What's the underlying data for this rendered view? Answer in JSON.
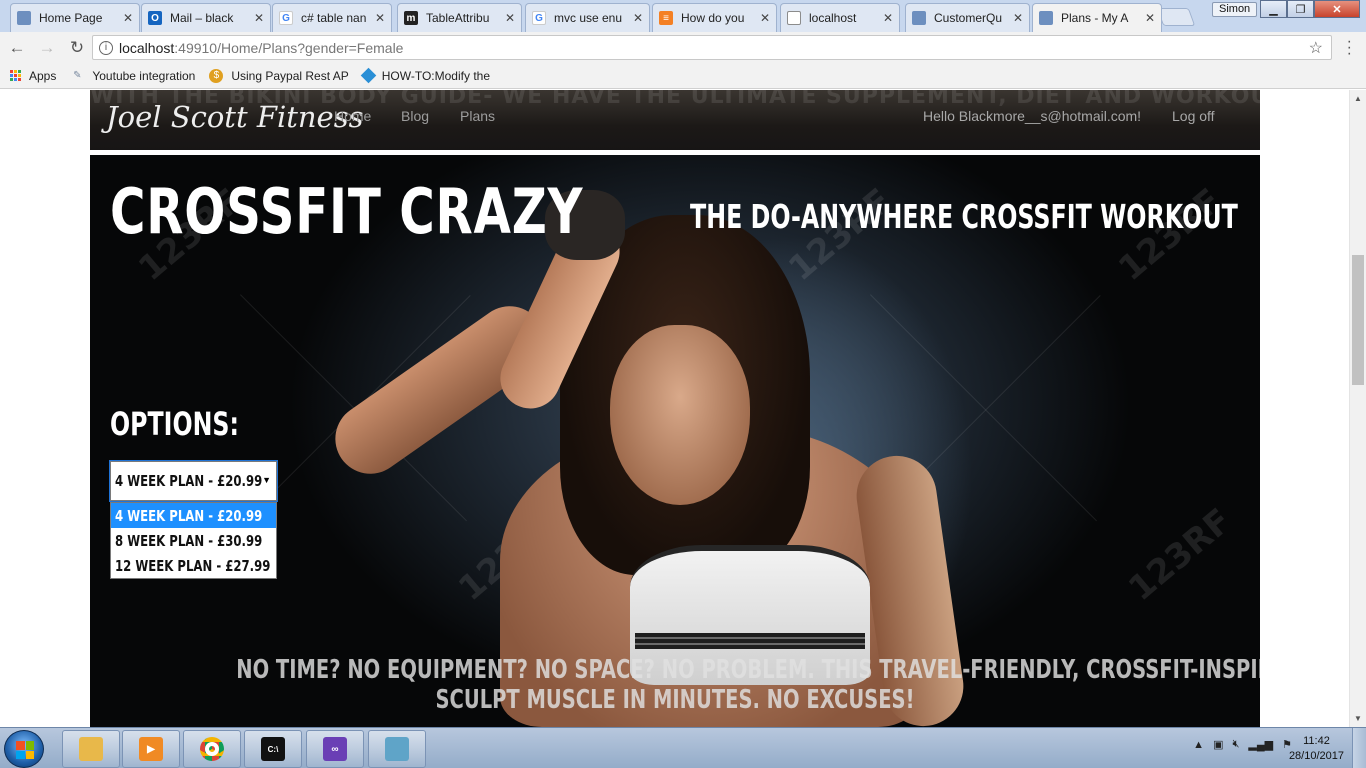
{
  "browser": {
    "tabs": [
      {
        "title": "Home Page",
        "icon": "page-icon",
        "color": "#6d8fbf"
      },
      {
        "title": "Mail – black",
        "icon": "outlook-icon",
        "color": "#1565c0"
      },
      {
        "title": "c# table nan",
        "icon": "google-icon",
        "color": "#4285f4"
      },
      {
        "title": "TableAttribu",
        "icon": "medium-icon",
        "color": "#222222"
      },
      {
        "title": "mvc use enu",
        "icon": "google-icon",
        "color": "#4285f4"
      },
      {
        "title": "How do you",
        "icon": "stackoverflow-icon",
        "color": "#f48024"
      },
      {
        "title": "localhost",
        "icon": "page-icon",
        "color": "#8c8c8c"
      },
      {
        "title": "CustomerQu",
        "icon": "page-icon",
        "color": "#6d8fbf"
      },
      {
        "title": "Plans - My A",
        "icon": "page-icon",
        "color": "#6d8fbf",
        "active": true
      }
    ],
    "profile": "Simon",
    "url_host": "localhost",
    "url_path": ":49910/Home/Plans?gender=Female",
    "bookmarks": {
      "apps_label": "Apps",
      "items": [
        {
          "label": "Youtube integration",
          "icon": "feather-icon"
        },
        {
          "label": "Using Paypal Rest AP",
          "icon": "coin-icon"
        },
        {
          "label": "HOW-TO:Modify the",
          "icon": "diamond-icon"
        }
      ]
    }
  },
  "site": {
    "banner_text": "WITH THE BIKINI BODY GUIDE- WE HAVE THE ULTIMATE SUPPLEMENT, DIET AND WORKOUT REGIME FOR YOU TO FOLLOW THIS SUMMER.",
    "brand": "Joel Scott Fitness",
    "nav": {
      "home": "Home",
      "blog": "Blog",
      "plans": "Plans"
    },
    "greeting": "Hello Blackmore__s@hotmail.com!",
    "logoff": "Log off"
  },
  "hero": {
    "title": "CROSSFIT CRAZY",
    "subtitle": "THE DO-ANYWHERE CROSSFIT WORKOUT",
    "options_label": "OPTIONS:",
    "selected_option": "4 WEEK PLAN - £20.99",
    "options": [
      "4 WEEK PLAN - £20.99",
      "8 WEEK PLAN - £30.99",
      "12 WEEK PLAN - £27.99"
    ],
    "tagline_line1": "NO TIME? NO EQUIPMENT? NO SPACE? NO PROBLEM. THIS TRAVEL-FRIENDLY, CROSSFIT-INSPIRED WORKOUT WILL BLAST FAT AND",
    "tagline_line2": "SCULPT MUSCLE IN MINUTES. NO EXCUSES!",
    "watermark": "123RF"
  },
  "taskbar": {
    "time": "11:42",
    "date": "28/10/2017",
    "apps": [
      {
        "name": "explorer-icon",
        "color": "#e8b84a"
      },
      {
        "name": "media-player-icon",
        "color": "#f08a24"
      },
      {
        "name": "chrome-icon",
        "color": "#db4437"
      },
      {
        "name": "cmd-icon",
        "color": "#111111"
      },
      {
        "name": "visual-studio-icon",
        "color": "#6a3fb5"
      },
      {
        "name": "notepad-icon",
        "color": "#5fa4c8"
      }
    ]
  },
  "colors": {
    "select_highlight": "#1e90ff",
    "navbar_bg": "#1c1917",
    "taskbar_bg": "#a3b8d3"
  }
}
